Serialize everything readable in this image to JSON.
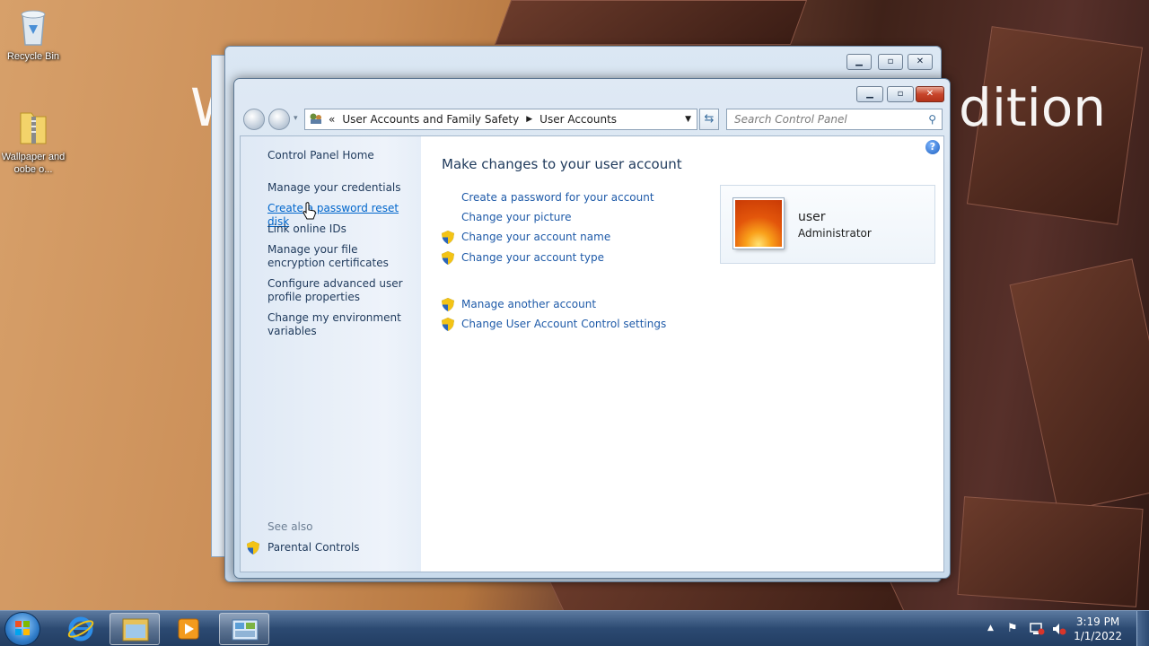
{
  "desktop": {
    "watermark_left": "W",
    "watermark_right": "dition",
    "icons": [
      {
        "label": "Recycle Bin",
        "icon": "recycle-bin-icon"
      },
      {
        "label": "Wallpaper and oobe o...",
        "icon": "zip-folder-icon"
      }
    ]
  },
  "window": {
    "nav": {
      "back": "back-icon",
      "forward": "forward-icon"
    },
    "address": {
      "chevron": "«",
      "crumbs": [
        "User Accounts and Family Safety",
        "User Accounts"
      ]
    },
    "search": {
      "placeholder": "Search Control Panel"
    },
    "left_pane": {
      "home": "Control Panel Home",
      "links": [
        "Manage your credentials",
        "Create a password reset disk",
        "Link online IDs",
        "Manage your file encryption certificates",
        "Configure advanced user profile properties",
        "Change my environment variables"
      ],
      "see_also_label": "See also",
      "see_also": [
        "Parental Controls"
      ]
    },
    "main": {
      "title": "Make changes to your user account",
      "tasks": [
        {
          "label": "Create a password for your account",
          "shield": false
        },
        {
          "label": "Change your picture",
          "shield": false
        },
        {
          "label": "Change your account name",
          "shield": true
        },
        {
          "label": "Change your account type",
          "shield": true
        }
      ],
      "tasks2": [
        {
          "label": "Manage another account",
          "shield": true
        },
        {
          "label": "Change User Account Control settings",
          "shield": true
        }
      ],
      "user": {
        "name": "user",
        "role": "Administrator"
      }
    }
  },
  "taskbar": {
    "clock_time": "3:19 PM",
    "clock_date": "1/1/2022",
    "pinned": [
      "internet-explorer-icon",
      "windows-explorer-icon",
      "media-player-icon",
      "control-panel-icon"
    ]
  }
}
